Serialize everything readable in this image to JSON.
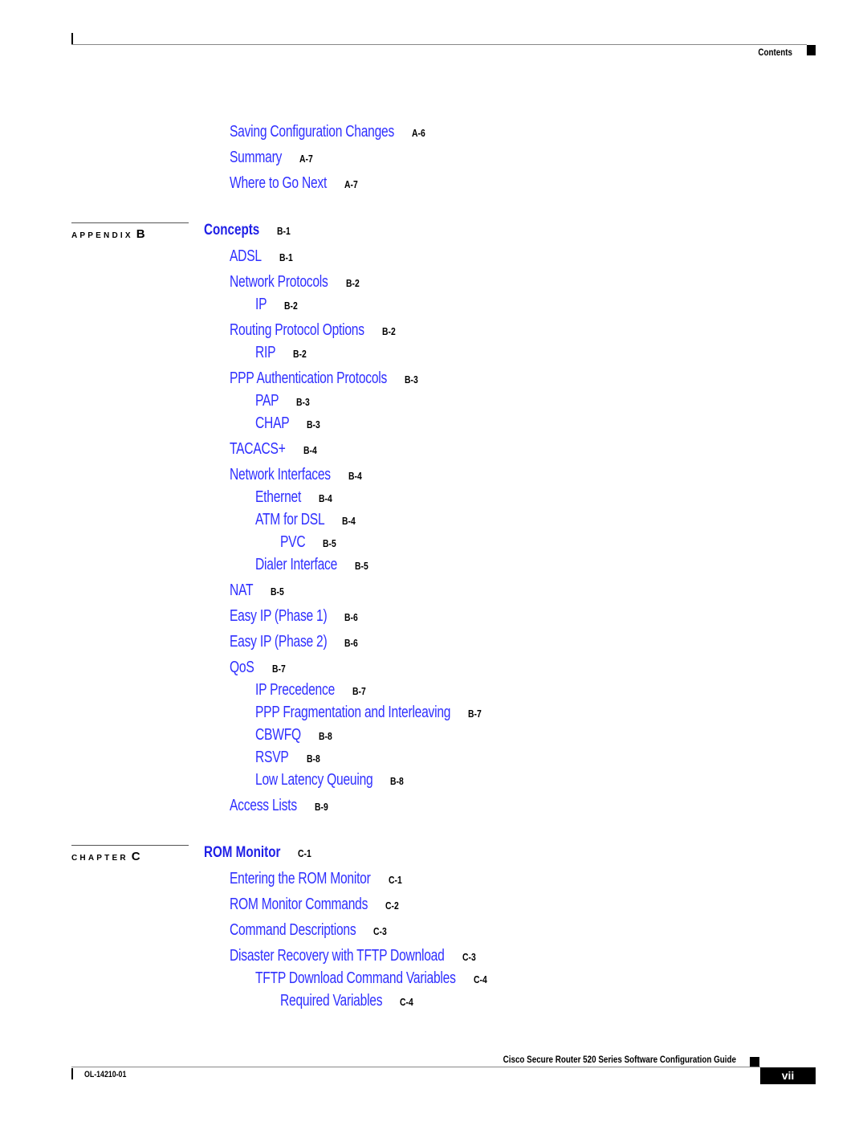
{
  "header": {
    "section": "Contents"
  },
  "toc": {
    "appendix_a_tail": [
      {
        "title": "Saving Configuration Changes",
        "page": "A-6",
        "level": 1
      },
      {
        "title": "Summary",
        "page": "A-7",
        "level": 1
      },
      {
        "title": "Where to Go Next",
        "page": "A-7",
        "level": 1
      }
    ],
    "appendix_b": {
      "label": "APPENDIX",
      "letter": "B",
      "title": "Concepts",
      "page": "B-1",
      "entries": [
        {
          "title": "ADSL",
          "page": "B-1",
          "level": 1
        },
        {
          "title": "Network Protocols",
          "page": "B-2",
          "level": 1
        },
        {
          "title": "IP",
          "page": "B-2",
          "level": 2
        },
        {
          "title": "Routing Protocol Options",
          "page": "B-2",
          "level": 1
        },
        {
          "title": "RIP",
          "page": "B-2",
          "level": 2
        },
        {
          "title": "PPP Authentication Protocols",
          "page": "B-3",
          "level": 1
        },
        {
          "title": "PAP",
          "page": "B-3",
          "level": 2
        },
        {
          "title": "CHAP",
          "page": "B-3",
          "level": 2
        },
        {
          "title": "TACACS+",
          "page": "B-4",
          "level": 1
        },
        {
          "title": "Network Interfaces",
          "page": "B-4",
          "level": 1
        },
        {
          "title": "Ethernet",
          "page": "B-4",
          "level": 2
        },
        {
          "title": "ATM for DSL",
          "page": "B-4",
          "level": 2
        },
        {
          "title": "PVC",
          "page": "B-5",
          "level": 3
        },
        {
          "title": "Dialer Interface",
          "page": "B-5",
          "level": 2
        },
        {
          "title": "NAT",
          "page": "B-5",
          "level": 1
        },
        {
          "title": "Easy IP (Phase 1)",
          "page": "B-6",
          "level": 1
        },
        {
          "title": "Easy IP (Phase 2)",
          "page": "B-6",
          "level": 1
        },
        {
          "title": "QoS",
          "page": "B-7",
          "level": 1
        },
        {
          "title": "IP Precedence",
          "page": "B-7",
          "level": 2
        },
        {
          "title": "PPP Fragmentation and Interleaving",
          "page": "B-7",
          "level": 2
        },
        {
          "title": "CBWFQ",
          "page": "B-8",
          "level": 2
        },
        {
          "title": "RSVP",
          "page": "B-8",
          "level": 2
        },
        {
          "title": "Low Latency Queuing",
          "page": "B-8",
          "level": 2
        },
        {
          "title": "Access Lists",
          "page": "B-9",
          "level": 1
        }
      ]
    },
    "chapter_c": {
      "label": "CHAPTER",
      "letter": "C",
      "title": "ROM Monitor",
      "page": "C-1",
      "entries": [
        {
          "title": "Entering the ROM Monitor",
          "page": "C-1",
          "level": 1
        },
        {
          "title": "ROM Monitor Commands",
          "page": "C-2",
          "level": 1
        },
        {
          "title": "Command Descriptions",
          "page": "C-3",
          "level": 1
        },
        {
          "title": "Disaster Recovery with TFTP Download",
          "page": "C-3",
          "level": 1
        },
        {
          "title": "TFTP Download Command Variables",
          "page": "C-4",
          "level": 2
        },
        {
          "title": "Required Variables",
          "page": "C-4",
          "level": 3
        }
      ]
    }
  },
  "footer": {
    "guide_title": "Cisco Secure Router 520 Series Software Configuration Guide",
    "doc_number": "OL-14210-01",
    "page_number": "vii"
  }
}
